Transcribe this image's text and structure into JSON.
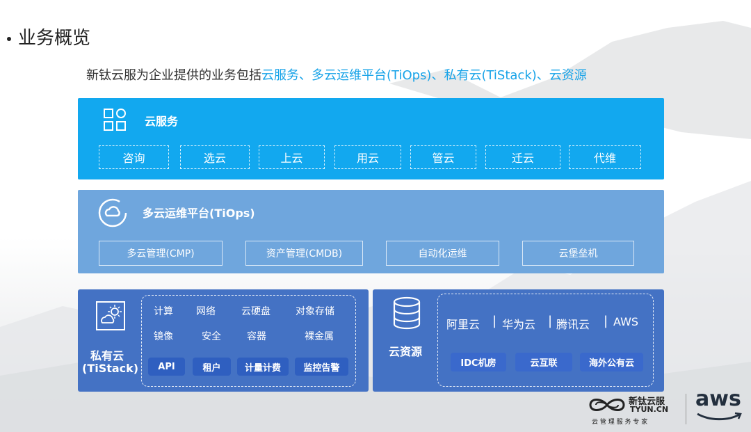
{
  "heading": "业务概览",
  "intro": {
    "prefix": "新钛云服为企业提供的业务包括",
    "highlight": "云服务、多云运维平台(TiOps)、私有云(TiStack)、云资源"
  },
  "cloud_services": {
    "title": "云服务",
    "icon": "grid-icon",
    "items": [
      "咨询",
      "选云",
      "上云",
      "用云",
      "管云",
      "迁云",
      "代维"
    ]
  },
  "tiops": {
    "title": "多云运维平台(TiOps)",
    "icon": "cloud-icon",
    "items": [
      "多云管理(CMP)",
      "资产管理(CMDB)",
      "自动化运维",
      "云堡垒机"
    ]
  },
  "tistack": {
    "title_line1": "私有云",
    "title_line2": "(TiStack)",
    "icon": "cloud-sun-icon",
    "row1": [
      "计算",
      "网络",
      "云硬盘",
      "对象存储"
    ],
    "row2": [
      "镜像",
      "安全",
      "容器",
      "裸金属"
    ],
    "pills": [
      "API",
      "租户",
      "计量计费",
      "监控告警"
    ]
  },
  "resources": {
    "title": "云资源",
    "icon": "database-icon",
    "providers": [
      "阿里云",
      "华为云",
      "腾讯云",
      "AWS"
    ],
    "pills": [
      "IDC机房",
      "云互联",
      "海外公有云"
    ]
  },
  "brand": {
    "cn": "新钛云服",
    "domain": "TYUN.CN",
    "tagline": "云 管 理 服 务 专 家",
    "partner": "aws"
  },
  "colors": {
    "band1": "#12a8ef",
    "band2": "#6fa6dd",
    "band3": "#4472c4",
    "highlight": "#17a3e8"
  }
}
